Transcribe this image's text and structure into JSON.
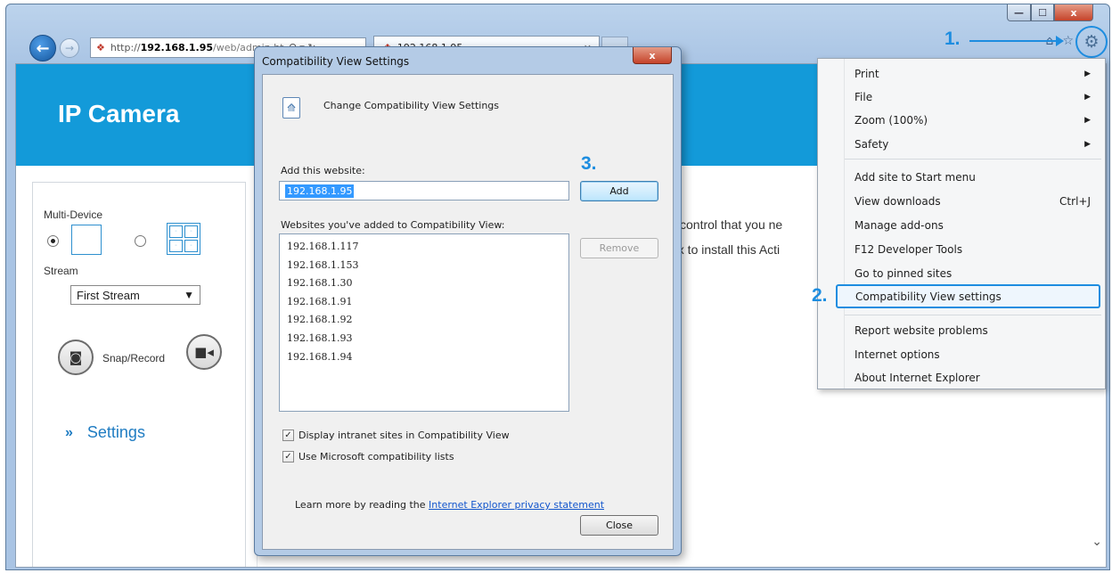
{
  "browser": {
    "address": {
      "proto": "http://",
      "host": "192.168.1.95",
      "path": "/web/admin.ht",
      "tools": "Ω ▾ ↻"
    },
    "tab": {
      "title": "192.168.1.95",
      "close": "×"
    },
    "caption": {
      "min": "—",
      "max": "☐",
      "close": "x"
    }
  },
  "callouts": {
    "step1": "1.",
    "step2": "2.",
    "step3": "3."
  },
  "page": {
    "brand": "IP Camera",
    "multi_device_label": "Multi-Device",
    "stream_label": "Stream",
    "stream_value": "First Stream",
    "snap_record_label": "Snap/Record",
    "settings_label": "Settings",
    "settings_chevron": "»",
    "activex_line1": "control that you ne",
    "activex_line2": "ox to install this Acti"
  },
  "tools_menu": {
    "items": [
      {
        "label": "Print",
        "submenu": "▶"
      },
      {
        "label": "File",
        "submenu": "▶"
      },
      {
        "label": "Zoom (100%)",
        "submenu": "▶"
      },
      {
        "label": "Safety",
        "submenu": "▶"
      },
      {
        "label": "Add site to Start menu"
      },
      {
        "label": "View downloads",
        "shortcut": "Ctrl+J"
      },
      {
        "label": "Manage add-ons"
      },
      {
        "label": "F12 Developer Tools"
      },
      {
        "label": "Go to pinned sites"
      },
      {
        "label": "Compatibility View settings"
      },
      {
        "label": "Report website problems"
      },
      {
        "label": "Internet options"
      },
      {
        "label": "About Internet Explorer"
      }
    ]
  },
  "dialog": {
    "title": "Compatibility View Settings",
    "close": "x",
    "heading": "Change Compatibility View Settings",
    "add_label": "Add this website:",
    "add_value": "192.168.1.95",
    "add_button": "Add",
    "list_label": "Websites you've added to Compatibility View:",
    "sites": [
      "192.168.1.117",
      "192.168.1.153",
      "192.168.1.30",
      "192.168.1.91",
      "192.168.1.92",
      "192.168.1.93",
      "192.168.1.94"
    ],
    "remove_button": "Remove",
    "check_intranet": "Display intranet sites in Compatibility View",
    "check_ms_lists": "Use Microsoft compatibility lists",
    "learn_more": "Learn more by reading the ",
    "privacy_link": "Internet Explorer privacy statement",
    "close_button": "Close",
    "check_mark": "✓"
  },
  "colors": {
    "accent": "#1d8de0",
    "banner": "#139ad9"
  }
}
